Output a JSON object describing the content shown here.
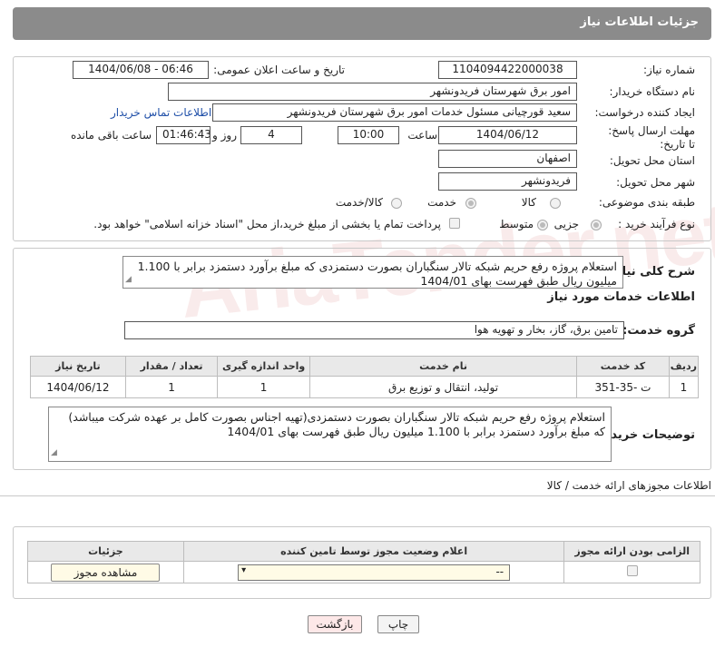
{
  "header": {
    "title": "جزئیات اطلاعات نیاز"
  },
  "fields": {
    "need_number": {
      "label": "شماره نیاز:",
      "value": "1104094422000038"
    },
    "announce_datetime": {
      "label": "تاریخ و ساعت اعلان عمومی:",
      "value": "1404/06/08 - 06:46"
    },
    "buyer_org": {
      "label": "نام دستگاه خریدار:",
      "value": "امور برق شهرستان فریدونشهر"
    },
    "requester": {
      "label": "ایجاد کننده درخواست:",
      "value": "سعید قورچیانی مسئول خدمات امور برق شهرستان فریدونشهر",
      "contact_link": "اطلاعات تماس خریدار"
    },
    "deadline": {
      "label": "مهلت ارسال پاسخ: تا تاریخ:",
      "date": "1404/06/12",
      "time_label": "ساعت",
      "time": "10:00",
      "days": "4",
      "days_label": "روز و",
      "remaining": "01:46:43",
      "remaining_label": "ساعت باقی مانده"
    },
    "province": {
      "label": "استان محل تحویل:",
      "value": "اصفهان"
    },
    "city": {
      "label": "شهر محل تحویل:",
      "value": "فریدونشهر"
    },
    "category": {
      "label": "طبقه بندی موضوعی:",
      "options": [
        "کالا",
        "خدمت",
        "کالا/خدمت"
      ],
      "selected": "خدمت"
    },
    "process": {
      "label": "نوع فرآیند خرید :",
      "options": [
        "جزیی",
        "متوسط"
      ],
      "selected": "جزیی",
      "payment_note": "پرداخت تمام یا بخشی از مبلغ خرید،از محل \"اسناد خزانه اسلامی\" خواهد بود."
    }
  },
  "description": {
    "label": "شرح کلی نیاز:",
    "text": "استعلام پروژه رفع حریم شبکه تالار سنگباران بصورت دستمزدی که مبلغ برآورد دستمزد برابر با 1.100 میلیون ریال طبق فهرست بهای 1404/01"
  },
  "services": {
    "title": "اطلاعات خدمات مورد نیاز",
    "group_label": "گروه خدمت:",
    "group_value": "تامین برق، گاز، بخار و تهویه هوا",
    "columns": [
      "ردیف",
      "کد خدمت",
      "نام خدمت",
      "واحد اندازه گیری",
      "تعداد / مقدار",
      "تاریخ نیاز"
    ],
    "rows": [
      {
        "row": "1",
        "code": "ت -35-351",
        "name": "تولید، انتقال و توزیع برق",
        "unit": "1",
        "qty": "1",
        "date": "1404/06/12"
      }
    ]
  },
  "buyer_notes": {
    "label": "توضیحات خریدار:",
    "text": "استعلام پروژه رفع حریم شبکه تالار سنگباران بصورت دستمزدی(تهیه اجناس بصورت کامل بر عهده شرکت میباشد) که مبلغ برآورد دستمزد برابر با 1.100 میلیون ریال طبق فهرست بهای 1404/01"
  },
  "permits": {
    "title": "اطلاعات مجوزهای ارائه خدمت / کالا",
    "columns": [
      "الزامی بودن ارائه مجوز",
      "اعلام وضعیت مجوز توسط تامین کننده",
      "جزئیات"
    ],
    "select_value": "--",
    "view_button": "مشاهده مجوز"
  },
  "footer": {
    "print_button": "چاپ",
    "back_button": "بازگشت"
  },
  "watermark": "AriaTender.net"
}
